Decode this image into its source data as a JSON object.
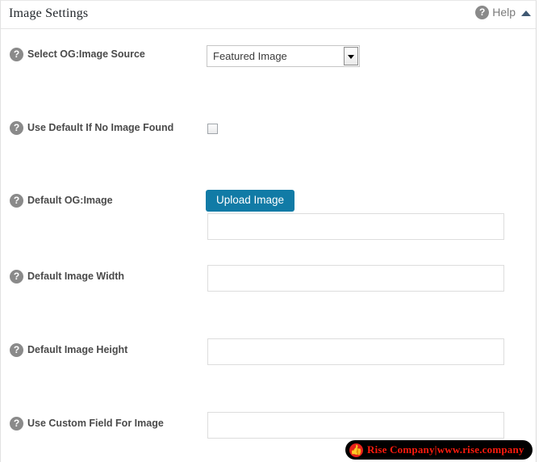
{
  "header": {
    "title": "Image Settings",
    "help_label": "Help",
    "help_icon": "question-circle-icon",
    "collapse_icon": "triangle-up-icon"
  },
  "fields": [
    {
      "id": "og-image-source",
      "label": "Select OG:Image Source",
      "help_icon": "question-circle-icon",
      "control": "select",
      "value": "Featured Image"
    },
    {
      "id": "use-default-if-no-image",
      "label": "Use Default If No Image Found",
      "help_icon": "question-circle-icon",
      "control": "checkbox",
      "checked": false
    },
    {
      "id": "default-og-image",
      "label": "Default OG:Image",
      "help_icon": "question-circle-icon",
      "control": "upload",
      "button_label": "Upload Image",
      "value": "",
      "placeholder": ""
    },
    {
      "id": "default-image-width",
      "label": "Default Image Width",
      "help_icon": "question-circle-icon",
      "control": "text",
      "value": "",
      "placeholder": ""
    },
    {
      "id": "default-image-height",
      "label": "Default Image Height",
      "help_icon": "question-circle-icon",
      "control": "text",
      "value": "",
      "placeholder": ""
    },
    {
      "id": "use-custom-field-for-image",
      "label": "Use Custom Field For Image",
      "help_icon": "question-circle-icon",
      "control": "text",
      "value": "",
      "placeholder": ""
    }
  ],
  "watermark": {
    "text": "Rise Company|www.rise.company",
    "icon": "thumbs-up-icon",
    "icon_glyph": "👍",
    "background_color": "#000000",
    "text_color": "#ff1a0d",
    "icon_color": "#e8211a"
  },
  "colors": {
    "accent_blue": "#117ba6",
    "label_gray": "#4a4a4a",
    "help_gray": "#8a8a8a"
  }
}
